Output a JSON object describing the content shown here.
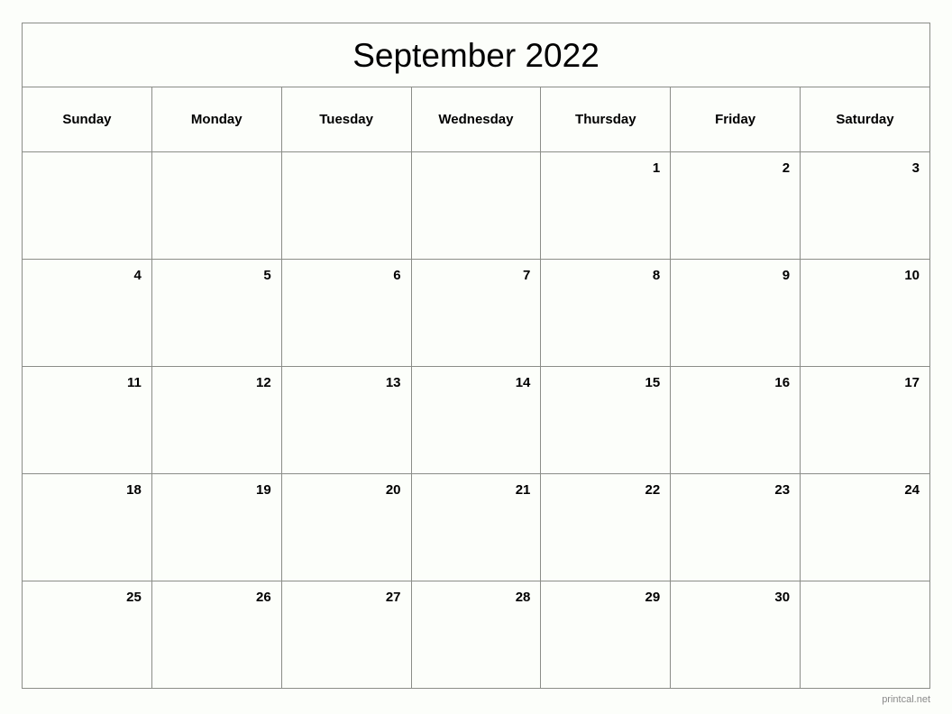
{
  "calendar": {
    "title": "September 2022",
    "weekday_headers": [
      "Sunday",
      "Monday",
      "Tuesday",
      "Wednesday",
      "Thursday",
      "Friday",
      "Saturday"
    ],
    "weeks": [
      [
        "",
        "",
        "",
        "",
        "1",
        "2",
        "3"
      ],
      [
        "4",
        "5",
        "6",
        "7",
        "8",
        "9",
        "10"
      ],
      [
        "11",
        "12",
        "13",
        "14",
        "15",
        "16",
        "17"
      ],
      [
        "18",
        "19",
        "20",
        "21",
        "22",
        "23",
        "24"
      ],
      [
        "25",
        "26",
        "27",
        "28",
        "29",
        "30",
        ""
      ]
    ]
  },
  "footer": {
    "credit": "printcal.net"
  },
  "colors": {
    "page_background": "#fcfefa",
    "grid_border": "#8b8d88",
    "text": "#000000",
    "footer_text": "#8a8a8a"
  }
}
